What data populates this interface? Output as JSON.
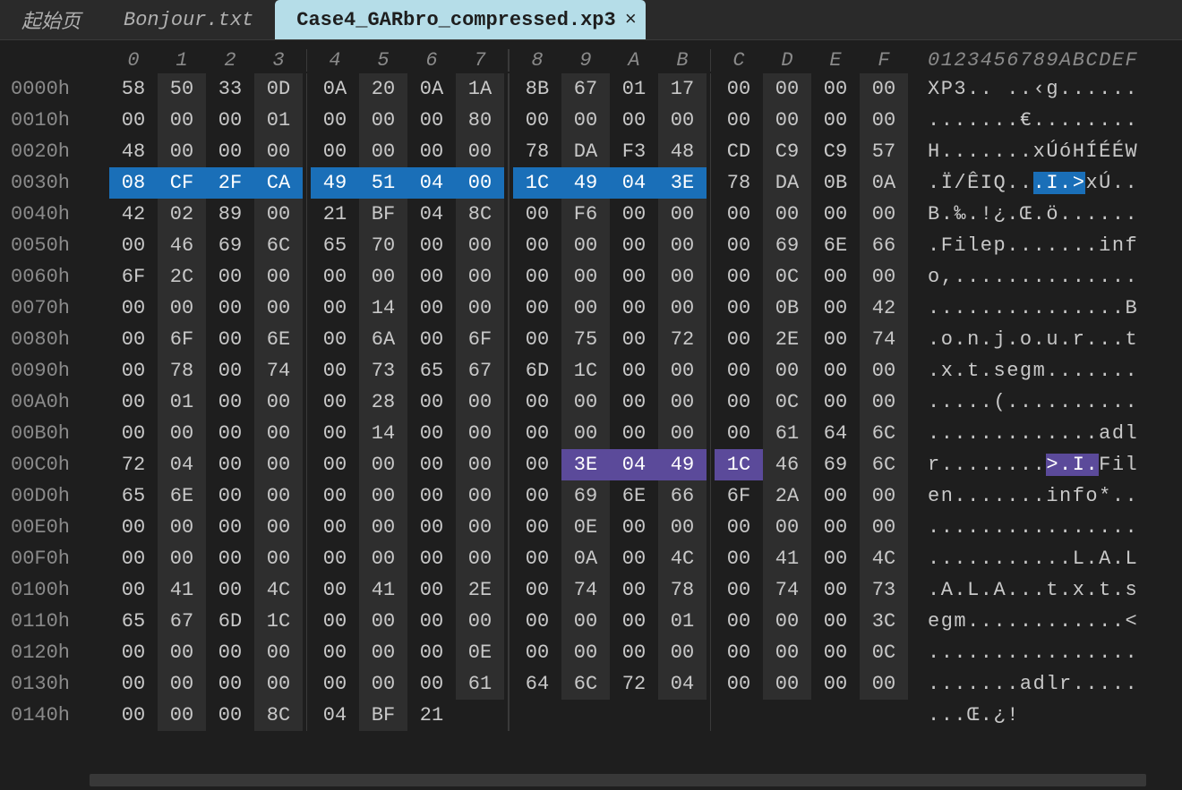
{
  "tabs": [
    {
      "label": "起始页"
    },
    {
      "label": "Bonjour.txt"
    },
    {
      "label": "Case4_GARbro_compressed.xp3",
      "active": true,
      "close": "×"
    }
  ],
  "hex_header": [
    "0",
    "1",
    "2",
    "3",
    "4",
    "5",
    "6",
    "7",
    "8",
    "9",
    "A",
    "B",
    "C",
    "D",
    "E",
    "F"
  ],
  "ascii_header": "0123456789ABCDEF",
  "rows": [
    {
      "addr": "0000h",
      "hex": [
        "58",
        "50",
        "33",
        "0D",
        "0A",
        "20",
        "0A",
        "1A",
        "8B",
        "67",
        "01",
        "17",
        "00",
        "00",
        "00",
        "00"
      ],
      "ascii": "XP3.. ..‹g......"
    },
    {
      "addr": "0010h",
      "hex": [
        "00",
        "00",
        "00",
        "01",
        "00",
        "00",
        "00",
        "80",
        "00",
        "00",
        "00",
        "00",
        "00",
        "00",
        "00",
        "00"
      ],
      "ascii": ".......€........"
    },
    {
      "addr": "0020h",
      "hex": [
        "48",
        "00",
        "00",
        "00",
        "00",
        "00",
        "00",
        "00",
        "78",
        "DA",
        "F3",
        "48",
        "CD",
        "C9",
        "C9",
        "57"
      ],
      "ascii": "H.......xÚóHÍÉÉW"
    },
    {
      "addr": "0030h",
      "hex": [
        "08",
        "CF",
        "2F",
        "CA",
        "49",
        "51",
        "04",
        "00",
        "1C",
        "49",
        "04",
        "3E",
        "78",
        "DA",
        "0B",
        "0A"
      ],
      "ascii": ".Ï/ÊIQ...I.>xÚ..",
      "selBlue": [
        0,
        12
      ],
      "asciiSelBlue": [
        8,
        12
      ]
    },
    {
      "addr": "0040h",
      "hex": [
        "42",
        "02",
        "89",
        "00",
        "21",
        "BF",
        "04",
        "8C",
        "00",
        "F6",
        "00",
        "00",
        "00",
        "00",
        "00",
        "00"
      ],
      "ascii": "B.‰.!¿.Œ.ö......"
    },
    {
      "addr": "0050h",
      "hex": [
        "00",
        "46",
        "69",
        "6C",
        "65",
        "70",
        "00",
        "00",
        "00",
        "00",
        "00",
        "00",
        "00",
        "69",
        "6E",
        "66"
      ],
      "ascii": ".Filep.......inf"
    },
    {
      "addr": "0060h",
      "hex": [
        "6F",
        "2C",
        "00",
        "00",
        "00",
        "00",
        "00",
        "00",
        "00",
        "00",
        "00",
        "00",
        "00",
        "0C",
        "00",
        "00"
      ],
      "ascii": "o,.............."
    },
    {
      "addr": "0070h",
      "hex": [
        "00",
        "00",
        "00",
        "00",
        "00",
        "14",
        "00",
        "00",
        "00",
        "00",
        "00",
        "00",
        "00",
        "0B",
        "00",
        "42"
      ],
      "ascii": "...............B"
    },
    {
      "addr": "0080h",
      "hex": [
        "00",
        "6F",
        "00",
        "6E",
        "00",
        "6A",
        "00",
        "6F",
        "00",
        "75",
        "00",
        "72",
        "00",
        "2E",
        "00",
        "74"
      ],
      "ascii": ".o.n.j.o.u.r...t"
    },
    {
      "addr": "0090h",
      "hex": [
        "00",
        "78",
        "00",
        "74",
        "00",
        "73",
        "65",
        "67",
        "6D",
        "1C",
        "00",
        "00",
        "00",
        "00",
        "00",
        "00"
      ],
      "ascii": ".x.t.segm......."
    },
    {
      "addr": "00A0h",
      "hex": [
        "00",
        "01",
        "00",
        "00",
        "00",
        "28",
        "00",
        "00",
        "00",
        "00",
        "00",
        "00",
        "00",
        "0C",
        "00",
        "00"
      ],
      "ascii": ".....(.........."
    },
    {
      "addr": "00B0h",
      "hex": [
        "00",
        "00",
        "00",
        "00",
        "00",
        "14",
        "00",
        "00",
        "00",
        "00",
        "00",
        "00",
        "00",
        "61",
        "64",
        "6C"
      ],
      "ascii": ".............adl"
    },
    {
      "addr": "00C0h",
      "hex": [
        "72",
        "04",
        "00",
        "00",
        "00",
        "00",
        "00",
        "00",
        "00",
        "3E",
        "04",
        "49",
        "1C",
        "46",
        "69",
        "6C"
      ],
      "ascii": "r........>.I.Fil",
      "selPurple": [
        9,
        13
      ],
      "asciiSelPurple": [
        9,
        13
      ]
    },
    {
      "addr": "00D0h",
      "hex": [
        "65",
        "6E",
        "00",
        "00",
        "00",
        "00",
        "00",
        "00",
        "00",
        "69",
        "6E",
        "66",
        "6F",
        "2A",
        "00",
        "00"
      ],
      "ascii": "en.......info*.."
    },
    {
      "addr": "00E0h",
      "hex": [
        "00",
        "00",
        "00",
        "00",
        "00",
        "00",
        "00",
        "00",
        "00",
        "0E",
        "00",
        "00",
        "00",
        "00",
        "00",
        "00"
      ],
      "ascii": "................"
    },
    {
      "addr": "00F0h",
      "hex": [
        "00",
        "00",
        "00",
        "00",
        "00",
        "00",
        "00",
        "00",
        "00",
        "0A",
        "00",
        "4C",
        "00",
        "41",
        "00",
        "4C"
      ],
      "ascii": "...........L.A.L"
    },
    {
      "addr": "0100h",
      "hex": [
        "00",
        "41",
        "00",
        "4C",
        "00",
        "41",
        "00",
        "2E",
        "00",
        "74",
        "00",
        "78",
        "00",
        "74",
        "00",
        "73"
      ],
      "ascii": ".A.L.A...t.x.t.s"
    },
    {
      "addr": "0110h",
      "hex": [
        "65",
        "67",
        "6D",
        "1C",
        "00",
        "00",
        "00",
        "00",
        "00",
        "00",
        "00",
        "01",
        "00",
        "00",
        "00",
        "3C"
      ],
      "ascii": "egm............<"
    },
    {
      "addr": "0120h",
      "hex": [
        "00",
        "00",
        "00",
        "00",
        "00",
        "00",
        "00",
        "0E",
        "00",
        "00",
        "00",
        "00",
        "00",
        "00",
        "00",
        "0C"
      ],
      "ascii": "................"
    },
    {
      "addr": "0130h",
      "hex": [
        "00",
        "00",
        "00",
        "00",
        "00",
        "00",
        "00",
        "61",
        "64",
        "6C",
        "72",
        "04",
        "00",
        "00",
        "00",
        "00"
      ],
      "ascii": ".......adlr....."
    },
    {
      "addr": "0140h",
      "hex": [
        "00",
        "00",
        "00",
        "8C",
        "04",
        "BF",
        "21",
        "",
        "",
        "",
        "",
        "",
        "",
        "",
        "",
        ""
      ],
      "ascii": "...Œ.¿!"
    }
  ]
}
